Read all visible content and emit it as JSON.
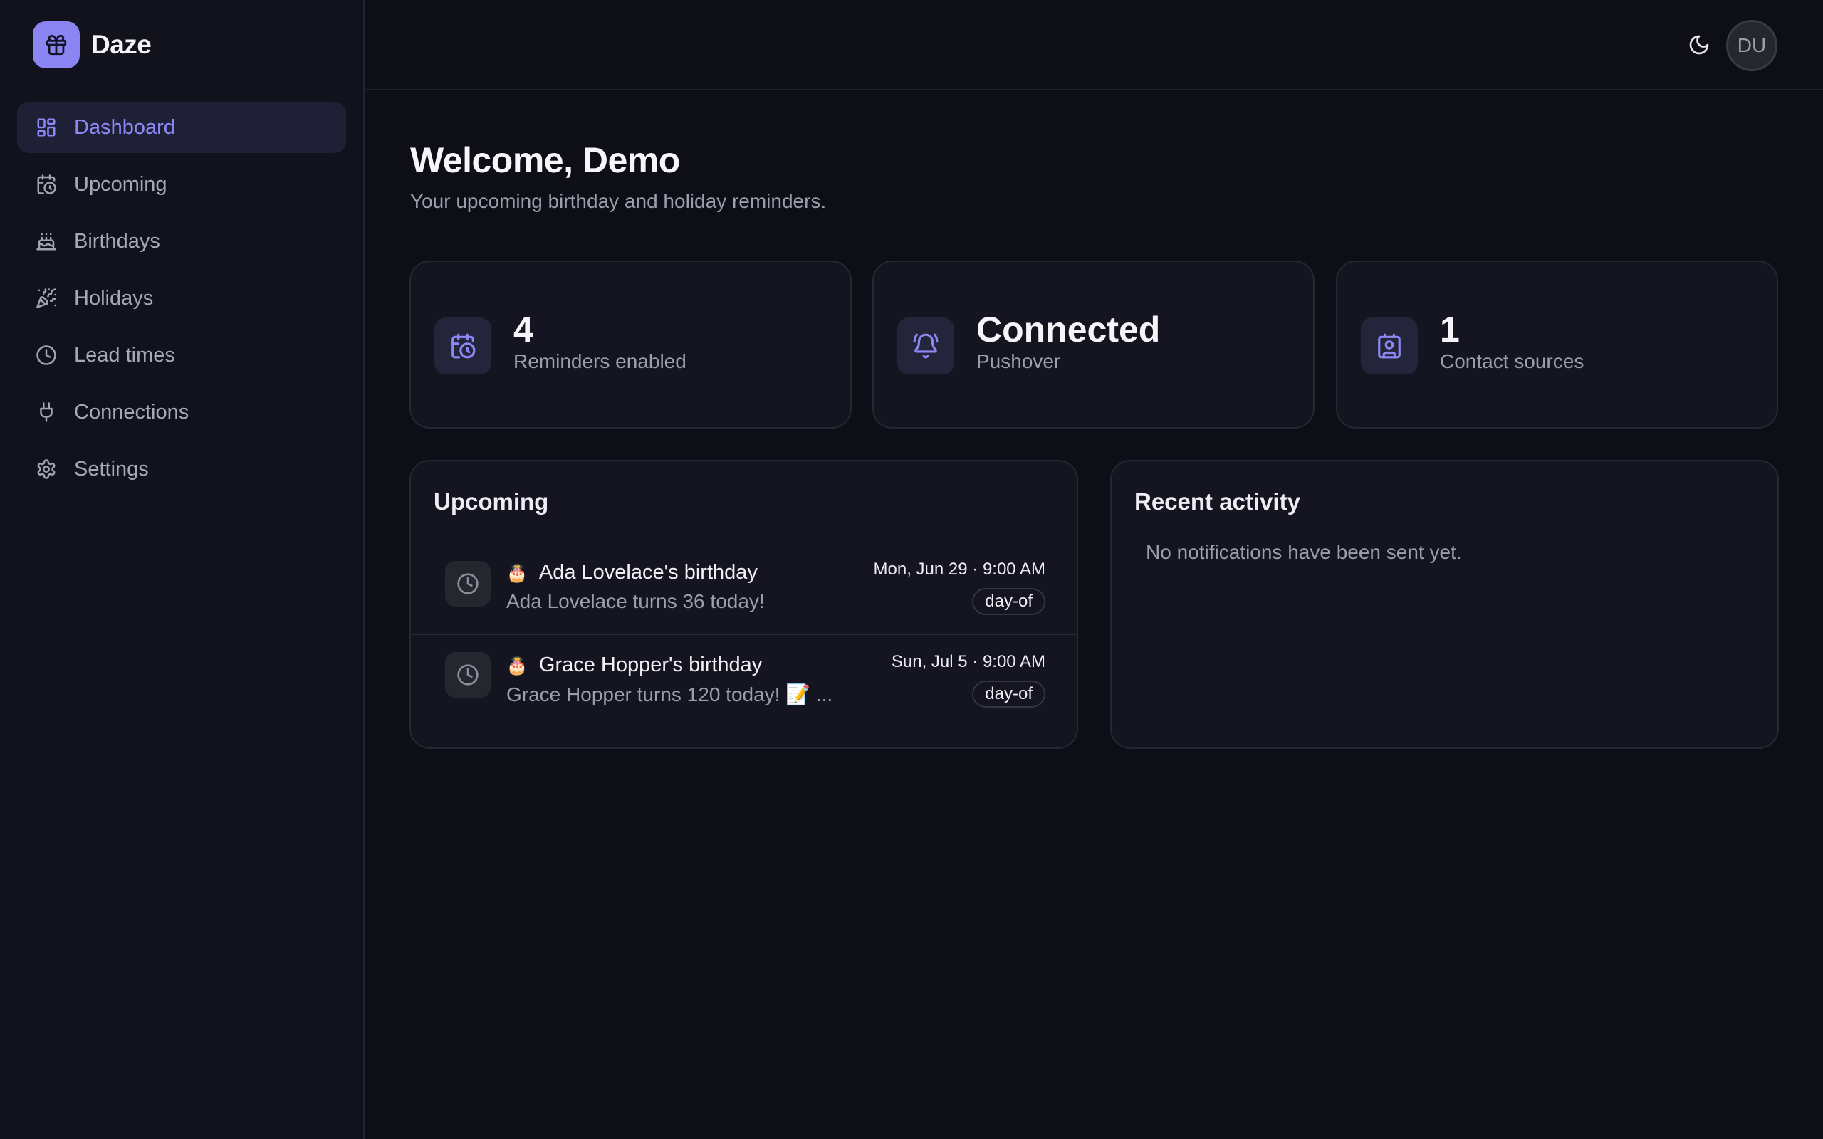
{
  "app": {
    "name": "Daze",
    "logo_icon": "gift-icon",
    "accent_color": "#8b84f3"
  },
  "sidebar": {
    "items": [
      {
        "label": "Dashboard",
        "icon": "dashboard-grid-icon",
        "active": true
      },
      {
        "label": "Upcoming",
        "icon": "calendar-clock-icon"
      },
      {
        "label": "Birthdays",
        "icon": "cake-icon"
      },
      {
        "label": "Holidays",
        "icon": "party-popper-icon"
      },
      {
        "label": "Lead times",
        "icon": "clock-icon"
      },
      {
        "label": "Connections",
        "icon": "plug-icon"
      },
      {
        "label": "Settings",
        "icon": "gear-icon"
      }
    ]
  },
  "header": {
    "theme_toggle_icon": "moon-icon",
    "avatar_initials": "DU"
  },
  "main": {
    "title": "Welcome, Demo",
    "subtitle": "Your upcoming birthday and holiday reminders.",
    "stats": [
      {
        "value": "4",
        "label": "Reminders enabled",
        "icon": "calendar-clock-icon"
      },
      {
        "value": "Connected",
        "label": "Pushover",
        "icon": "bell-ring-icon"
      },
      {
        "value": "1",
        "label": "Contact sources",
        "icon": "contact-icon"
      }
    ],
    "upcoming": {
      "title": "Upcoming",
      "events": [
        {
          "emoji": "🎂",
          "title": "Ada Lovelace's birthday",
          "subtitle": "Ada Lovelace turns 36 today!",
          "date": "Mon, Jun 29 · 9:00 AM",
          "badge": "day-of"
        },
        {
          "emoji": "🎂",
          "title": "Grace Hopper's birthday",
          "subtitle": "Grace Hopper turns 120 today! 📝 ...",
          "date": "Sun, Jul 5 · 9:00 AM",
          "badge": "day-of"
        }
      ]
    },
    "recent_activity": {
      "title": "Recent activity",
      "empty_text": "No notifications have been sent yet."
    }
  }
}
